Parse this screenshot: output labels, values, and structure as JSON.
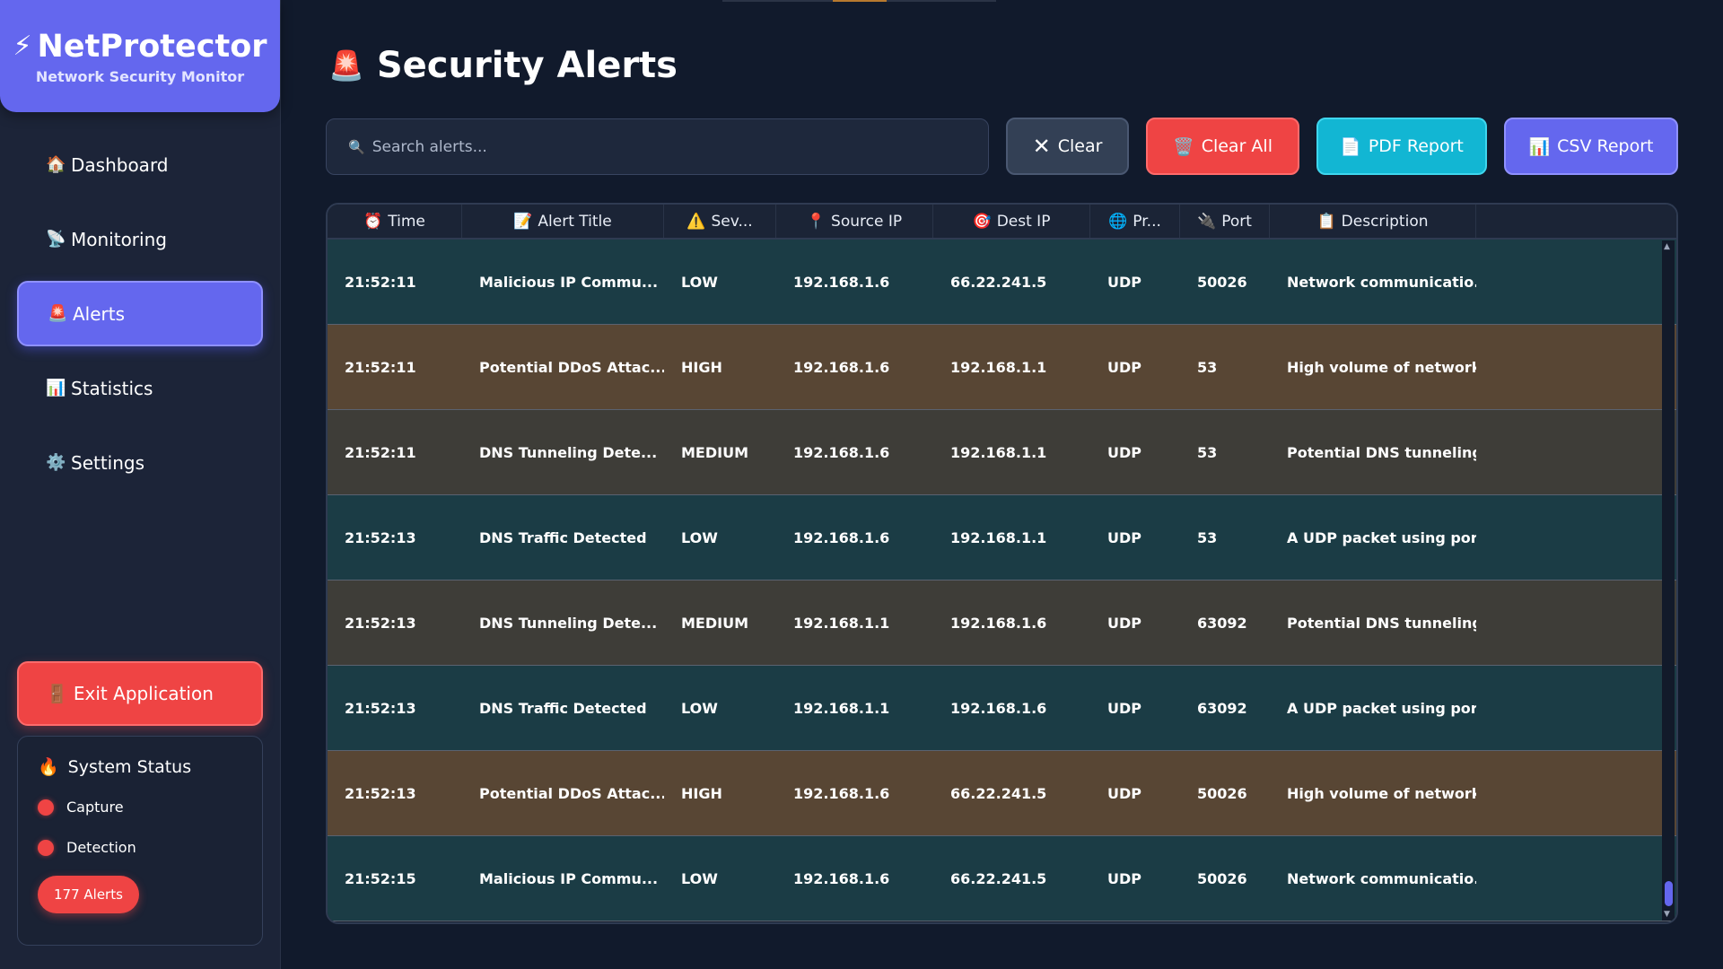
{
  "app": {
    "name": "NetProtector",
    "subtitle": "Network Security Monitor"
  },
  "sidebar": {
    "items": [
      {
        "icon": "🏠",
        "label": "Dashboard"
      },
      {
        "icon": "📡",
        "label": "Monitoring"
      },
      {
        "icon": "🚨",
        "label": "Alerts"
      },
      {
        "icon": "📊",
        "label": "Statistics"
      },
      {
        "icon": "⚙️",
        "label": "Settings"
      }
    ],
    "active": "Alerts",
    "exit_label": "Exit Application"
  },
  "status": {
    "title": "System Status",
    "capture_label": "Capture",
    "detection_label": "Detection",
    "alerts_badge": "177 Alerts",
    "colors": {
      "indicator": "#ef4444"
    }
  },
  "main": {
    "title": "Security Alerts",
    "search_placeholder": "Search alerts...",
    "buttons": {
      "clear": "Clear",
      "clear_all": "Clear All",
      "pdf": "PDF Report",
      "csv": "CSV Report"
    }
  },
  "table": {
    "headers": [
      "Time",
      "Alert Title",
      "Sev...",
      "Source IP",
      "Dest IP",
      "Pr...",
      "Port",
      "Description"
    ],
    "rows": [
      {
        "severity_class": "low",
        "cells": [
          "21:52:11",
          "Malicious IP Commu...",
          "LOW",
          "192.168.1.6",
          "66.22.241.5",
          "UDP",
          "50026",
          "Network communicatio..."
        ]
      },
      {
        "severity_class": "high",
        "cells": [
          "21:52:11",
          "Potential DDoS Attac...",
          "HIGH",
          "192.168.1.6",
          "192.168.1.1",
          "UDP",
          "53",
          "High volume of network..."
        ]
      },
      {
        "severity_class": "medium",
        "cells": [
          "21:52:11",
          "DNS Tunneling Dete...",
          "MEDIUM",
          "192.168.1.6",
          "192.168.1.1",
          "UDP",
          "53",
          "Potential DNS tunneling ..."
        ]
      },
      {
        "severity_class": "low",
        "cells": [
          "21:52:13",
          "DNS Traffic Detected",
          "LOW",
          "192.168.1.6",
          "192.168.1.1",
          "UDP",
          "53",
          "A UDP packet using por..."
        ]
      },
      {
        "severity_class": "medium",
        "cells": [
          "21:52:13",
          "DNS Tunneling Dete...",
          "MEDIUM",
          "192.168.1.1",
          "192.168.1.6",
          "UDP",
          "63092",
          "Potential DNS tunneling ..."
        ]
      },
      {
        "severity_class": "low",
        "cells": [
          "21:52:13",
          "DNS Traffic Detected",
          "LOW",
          "192.168.1.1",
          "192.168.1.6",
          "UDP",
          "63092",
          "A UDP packet using por..."
        ]
      },
      {
        "severity_class": "high",
        "cells": [
          "21:52:13",
          "Potential DDoS Attac...",
          "HIGH",
          "192.168.1.6",
          "66.22.241.5",
          "UDP",
          "50026",
          "High volume of network..."
        ]
      },
      {
        "severity_class": "low",
        "cells": [
          "21:52:15",
          "Malicious IP Commu...",
          "LOW",
          "192.168.1.6",
          "66.22.241.5",
          "UDP",
          "50026",
          "Network communicatio..."
        ]
      }
    ]
  },
  "colors": {
    "accent": "#6467ee",
    "danger": "#ef4444",
    "info": "#12b6d3",
    "row_low": "#1b3c45",
    "row_high": "#584634",
    "row_medium": "#3e3d38"
  }
}
